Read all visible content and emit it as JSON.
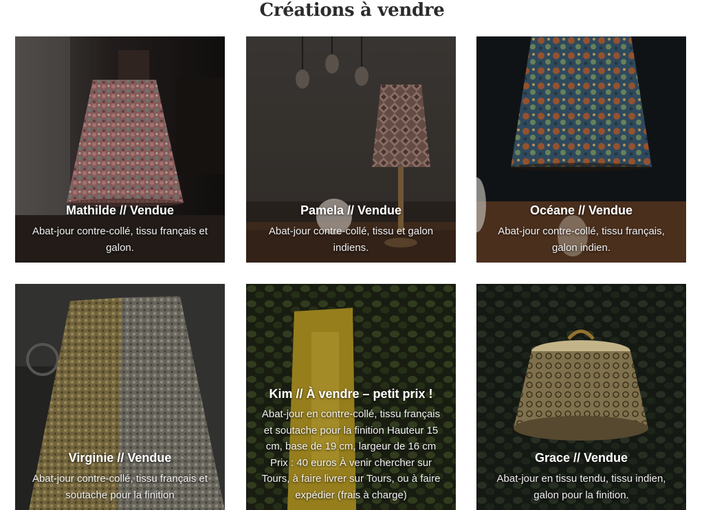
{
  "page": {
    "title": "Créations à vendre"
  },
  "cards": [
    {
      "title": "Mathilde // Vendue",
      "description": "Abat-jour contre-collé, tissu français et galon.",
      "image": "lampshade-photo"
    },
    {
      "title": "Pamela // Vendue",
      "description": "Abat-jour contre-collé, tissu et galon indiens.",
      "image": "lampshade-photo"
    },
    {
      "title": "Océane // Vendue",
      "description": "Abat-jour contre-collé, tissu français, galon indien.",
      "image": "lampshade-photo"
    },
    {
      "title": "Virginie // Vendue",
      "description": "Abat-jour contre-collé, tissu français et soutache pour la finition",
      "image": "lampshade-photo"
    },
    {
      "title": "Kim // À vendre – petit prix !",
      "description": "Abat-jour en contre-collé, tissu français et soutache pour la finition Hauteur 15 cm, base de 19 cm, largeur de 16 cm Prix : 40 euros À venir chercher sur Tours, à faire livrer sur Tours, ou à faire expédier (frais à charge)",
      "image": "lampshade-photo"
    },
    {
      "title": "Grace // Vendue",
      "description": "Abat-jour en tissu tendu, tissu indien, galon pour la finition.",
      "image": "lampshade-photo"
    }
  ]
}
